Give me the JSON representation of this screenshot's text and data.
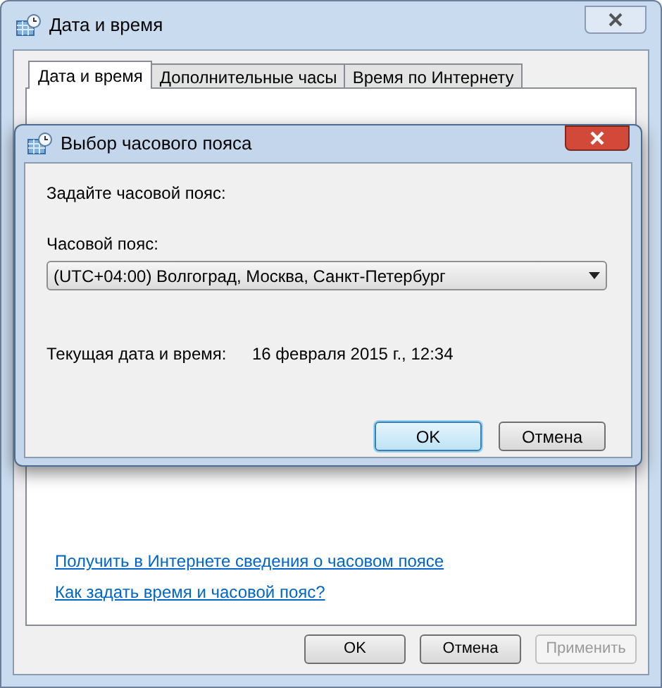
{
  "window": {
    "title": "Дата и время"
  },
  "tabs": [
    {
      "label": "Дата и время",
      "selected": true
    },
    {
      "label": "Дополнительные часы",
      "selected": false
    },
    {
      "label": "Время по Интернету",
      "selected": false
    }
  ],
  "links": [
    "Получить в Интернете сведения о часовом поясе",
    "Как задать время и часовой пояс?"
  ],
  "buttons": [
    {
      "label": "OK",
      "disabled": false
    },
    {
      "label": "Отмена",
      "disabled": false
    },
    {
      "label": "Применить",
      "disabled": true
    }
  ],
  "dialog": {
    "title": "Выбор часового пояса",
    "prompt": "Задайте часовой пояс:",
    "timezone_label": "Часовой пояс:",
    "timezone": "(UTC+04:00) Волгоград, Москва, Санкт-Петербург",
    "current_label": "Текущая дата и время:",
    "current_value": "16 февраля 2015 г., 12:34",
    "buttons": [
      {
        "label": "OK",
        "default": true
      },
      {
        "label": "Отмена",
        "default": false
      }
    ]
  }
}
